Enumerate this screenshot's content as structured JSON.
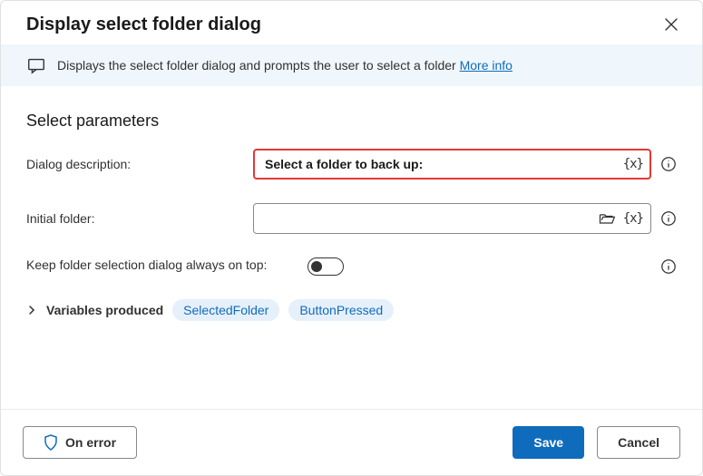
{
  "header": {
    "title": "Display select folder dialog"
  },
  "banner": {
    "text": "Displays the select folder dialog and prompts the user to select a folder",
    "link_label": "More info"
  },
  "section": {
    "title": "Select parameters"
  },
  "fields": {
    "description": {
      "label": "Dialog description:",
      "value": "Select a folder to back up:"
    },
    "initial_folder": {
      "label": "Initial folder:",
      "value": ""
    },
    "keep_on_top": {
      "label": "Keep folder selection dialog always on top:",
      "value": false
    }
  },
  "variables": {
    "label": "Variables produced",
    "chips": [
      "SelectedFolder",
      "ButtonPressed"
    ]
  },
  "footer": {
    "on_error": "On error",
    "save": "Save",
    "cancel": "Cancel"
  },
  "icons": {
    "var_token": "{x}"
  }
}
